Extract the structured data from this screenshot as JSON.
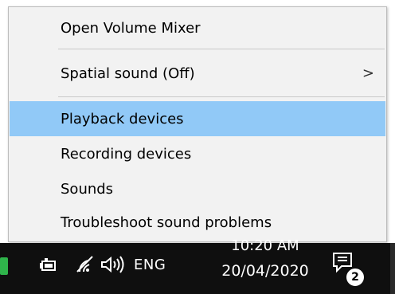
{
  "menu": {
    "items": [
      {
        "label": "Open Volume Mixer"
      },
      {
        "label": "Spatial sound (Off)",
        "submenu_indicator": ">"
      },
      {
        "label": "Playback devices"
      },
      {
        "label": "Recording devices"
      },
      {
        "label": "Sounds"
      },
      {
        "label": "Troubleshoot sound problems"
      }
    ],
    "highlighted_item": "Playback devices",
    "highlight_color": "#91c9f7",
    "background_color": "#f2f2f2"
  },
  "taskbar": {
    "background_color": "#0f0f0f",
    "tray_icons": [
      "app-icon",
      "battery-icon",
      "wifi-icon",
      "speaker-icon"
    ],
    "language": "ENG",
    "clock": {
      "time": "10:20 AM",
      "date": "20/04/2020"
    },
    "notification_icon": "action-center-icon",
    "notification_count": "2"
  }
}
